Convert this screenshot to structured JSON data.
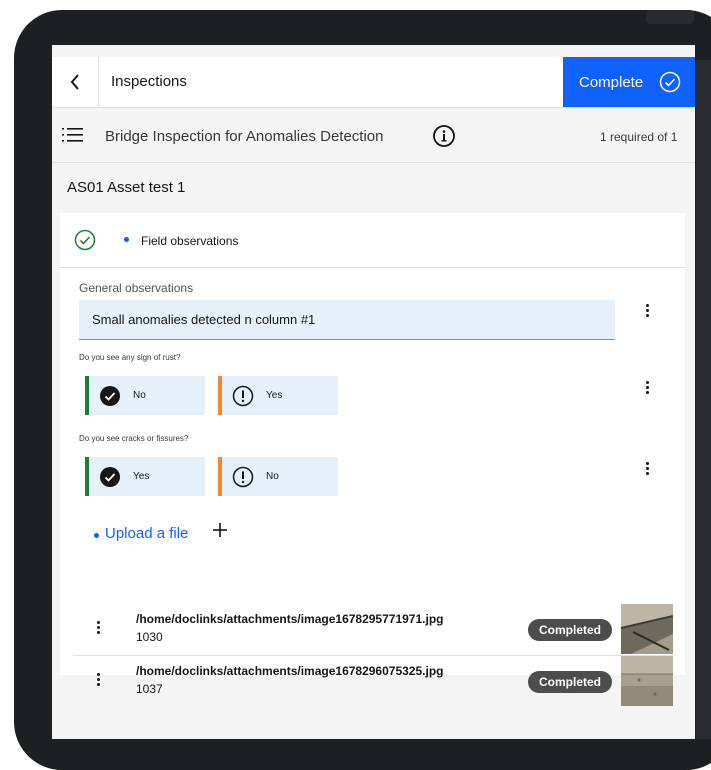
{
  "header": {
    "title": "Inspections",
    "complete_label": "Complete"
  },
  "subheader": {
    "title": "Bridge Inspection for Anomalies Detection",
    "required": "1 required of 1"
  },
  "asset": {
    "title": "AS01 Asset test 1"
  },
  "section": {
    "label": "Field observations"
  },
  "general": {
    "label": "General observations",
    "value": "Small anomalies detected n column #1"
  },
  "questions": [
    {
      "label": "Do you see any sign of rust?",
      "options": [
        {
          "label": "No"
        },
        {
          "label": "Yes"
        }
      ]
    },
    {
      "label": "Do you see cracks or fissures?",
      "options": [
        {
          "label": "Yes"
        },
        {
          "label": "No"
        }
      ]
    }
  ],
  "upload": {
    "label": "Upload a file"
  },
  "attachments": [
    {
      "path": "/home/doclinks/attachments/image1678295771971.jpg",
      "id": "1030",
      "status": "Completed"
    },
    {
      "path": "/home/doclinks/attachments/image1678296075325.jpg",
      "id": "1037",
      "status": "Completed"
    }
  ],
  "colors": {
    "accent": "#0f62fe",
    "success": "#198038",
    "warning": "#ff832b",
    "field_bg": "#e5f0fb"
  }
}
